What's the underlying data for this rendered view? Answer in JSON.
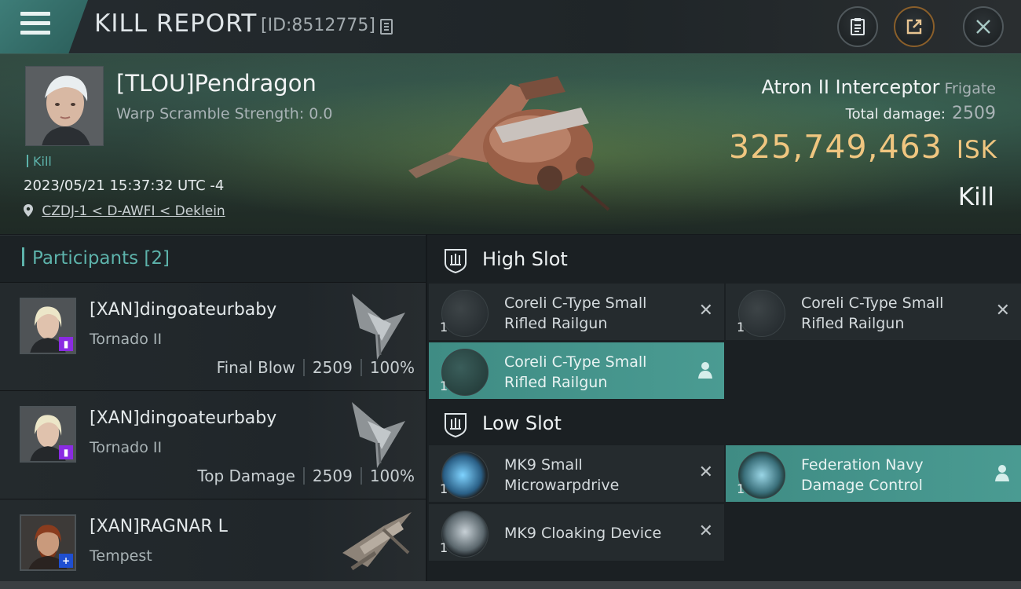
{
  "header": {
    "title": "KILL REPORT",
    "report_id": "[ID:8512775]"
  },
  "victim": {
    "name": "[TLOU]Pendragon",
    "warp_scramble": "Warp Scramble Strength: 0.0",
    "tag": "Kill",
    "datetime": "2023/05/21 15:37:32 UTC -4",
    "location": "CZDJ-1 < D-AWFI < Deklein",
    "ship": "Atron II Interceptor",
    "ship_class": "Frigate",
    "total_damage_label": "Total damage:",
    "total_damage": "2509",
    "isk_value": "325,749,463",
    "isk_unit": "ISK",
    "result": "Kill"
  },
  "participants": {
    "title": "Participants [2]",
    "rows": [
      {
        "name": "[XAN]dingoateurbaby",
        "ship": "Tornado II",
        "role": "Final Blow",
        "damage": "2509",
        "percent": "100%",
        "badge_color": "#8a2be2"
      },
      {
        "name": "[XAN]dingoateurbaby",
        "ship": "Tornado II",
        "role": "Top Damage",
        "damage": "2509",
        "percent": "100%",
        "badge_color": "#8a2be2"
      },
      {
        "name": "[XAN]RAGNAR L",
        "ship": "Tempest",
        "badge_color": "#1f4fd1"
      }
    ]
  },
  "fitting": {
    "high_slot_label": "High Slot",
    "low_slot_label": "Low Slot",
    "high": [
      {
        "qty": "1",
        "name": "Coreli C-Type Small Rifled Railgun",
        "status": "destroyed"
      },
      {
        "qty": "1",
        "name": "Coreli C-Type Small Rifled Railgun",
        "status": "destroyed"
      },
      {
        "qty": "1",
        "name": "Coreli C-Type Small Rifled Railgun",
        "status": "dropped"
      }
    ],
    "low": [
      {
        "qty": "1",
        "name": "MK9 Small Microwarpdrive",
        "status": "destroyed"
      },
      {
        "qty": "1",
        "name": "Federation Navy Damage Control",
        "status": "dropped"
      },
      {
        "qty": "1",
        "name": "MK9 Cloaking Device",
        "status": "destroyed"
      }
    ]
  },
  "colors": {
    "accent": "#5db3ab",
    "isk": "#f0c680",
    "active_module": "#4a9b92"
  },
  "icons": [
    "menu-icon",
    "copy-icon",
    "clipboard-icon",
    "share-icon",
    "close-icon",
    "pin-icon",
    "slot-icon",
    "person-icon",
    "x-icon"
  ]
}
